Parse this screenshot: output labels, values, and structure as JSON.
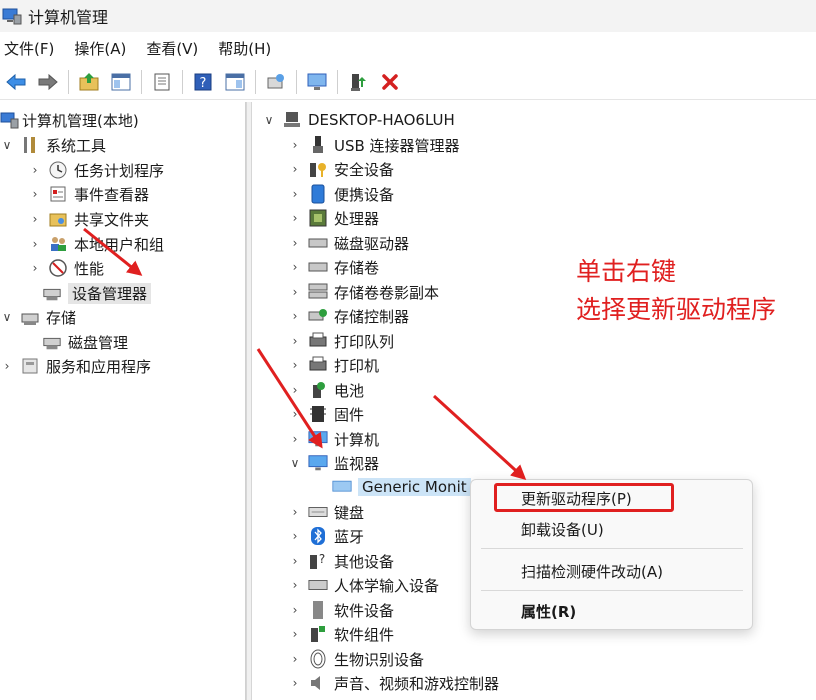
{
  "window": {
    "title": "计算机管理",
    "icon": "computer-management-icon"
  },
  "menubar": {
    "items": [
      "文件(F)",
      "操作(A)",
      "查看(V)",
      "帮助(H)"
    ]
  },
  "toolbar": {
    "icons": [
      "back-arrow-icon",
      "forward-arrow-icon",
      "up-folder-icon",
      "show-hide-tree-icon",
      "properties-sheet-icon",
      "help-icon",
      "action-pane-icon",
      "scan-hardware-icon",
      "monitor-icon",
      "driver-update-icon",
      "uninstall-x-icon"
    ]
  },
  "left_tree": {
    "root": "计算机管理(本地)",
    "system_tools": "系统工具",
    "task_scheduler": "任务计划程序",
    "event_viewer": "事件查看器",
    "shared_folders": "共享文件夹",
    "local_users": "本地用户和组",
    "performance": "性能",
    "device_manager": "设备管理器",
    "storage": "存储",
    "disk_management": "磁盘管理",
    "services": "服务和应用程序"
  },
  "device_tree": {
    "computer": "DESKTOP-HAO6LUH",
    "usb": "USB 连接器管理器",
    "security": "安全设备",
    "portable": "便携设备",
    "processor": "处理器",
    "disk_drives": "磁盘驱动器",
    "storage_volumes": "存储卷",
    "shadow_copies": "存储卷卷影副本",
    "storage_controllers": "存储控制器",
    "print_queue": "打印队列",
    "printer": "打印机",
    "battery": "电池",
    "firmware": "固件",
    "computer_cat": "计算机",
    "monitors": "监视器",
    "generic_monitor": "Generic Monit",
    "keyboard": "键盘",
    "bluetooth": "蓝牙",
    "other_devices": "其他设备",
    "hid": "人体学输入设备",
    "software_devices": "软件设备",
    "software_components": "软件组件",
    "biometric": "生物识别设备",
    "audio": "声音、视频和游戏控制器"
  },
  "context_menu": {
    "update_driver": "更新驱动程序(P)",
    "uninstall": "卸载设备(U)",
    "scan": "扫描检测硬件改动(A)",
    "properties": "属性(R)"
  },
  "annotation": {
    "line1": "单击右键",
    "line2": "选择更新驱动程序"
  },
  "colors": {
    "annotation_red": "#e02020",
    "selection_gray": "#e5e5e5",
    "selection_blue": "#cce4f7"
  }
}
